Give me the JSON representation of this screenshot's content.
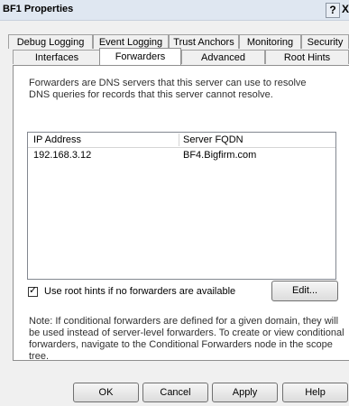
{
  "window": {
    "title": "BF1 Properties",
    "help_glyph": "?",
    "close_glyph": "X"
  },
  "tabs": {
    "row1": [
      "Debug Logging",
      "Event Logging",
      "Trust Anchors",
      "Monitoring",
      "Security"
    ],
    "row2": [
      "Interfaces",
      "Forwarders",
      "Advanced",
      "Root Hints"
    ],
    "active": "Forwarders"
  },
  "forwarders": {
    "description": "Forwarders are DNS servers that this server can use to resolve DNS queries for records that this server cannot resolve.",
    "columns": [
      "IP Address",
      "Server FQDN"
    ],
    "rows": [
      {
        "ip": "192.168.3.12",
        "fqdn": "BF4.Bigfirm.com"
      }
    ],
    "use_root_hints": {
      "checked": true,
      "label": "Use root hints if no forwarders are available"
    },
    "edit_label": "Edit...",
    "note": "Note: If conditional forwarders are defined for a given domain, they will be used instead of server-level forwarders. To create or view conditional forwarders, navigate to the Conditional Forwarders node in the scope tree."
  },
  "buttons": {
    "ok": "OK",
    "cancel": "Cancel",
    "apply": "Apply",
    "help": "Help"
  }
}
